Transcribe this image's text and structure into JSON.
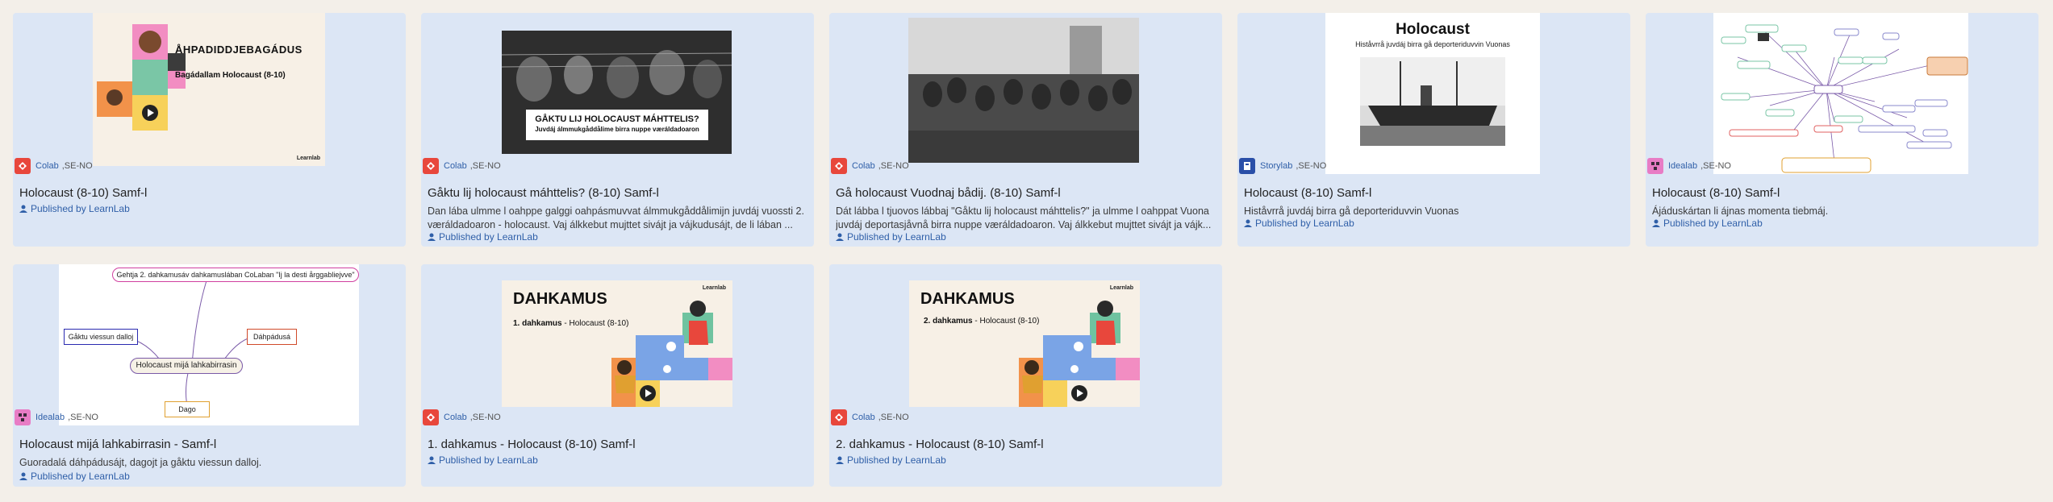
{
  "cards": [
    {
      "title": "Holocaust (8-10) Samf-l",
      "lab": "Colab",
      "lang": ",SE-NO",
      "description": "",
      "publisher": "Published by LearnLab",
      "thumb": {
        "heading": "ÅHPADIDDJEBAGÁDUS",
        "sub": "Bagádallam Holocaust (8-10)",
        "brand": "Learnlab"
      }
    },
    {
      "title": "Gåktu lij holocaust máhttelis? (8-10) Samf-l",
      "lab": "Colab",
      "lang": ",SE-NO",
      "description": "Dan lába ulmme l oahppe galggi oahpásmuvvat álmmukgåddålimijn juvdáj vuossti 2. væráldadoaron - holocaust. Vaj álkkebut mujttet sivájt ja vájkudusájt, de li lában ...",
      "publisher": "Published by LearnLab",
      "thumb": {
        "heading": "GÅKTU LIJ HOLOCAUST MÁHTTELIS?",
        "sub": "Juvdáj álmmukgåddålime birra nuppe væráldadoaron"
      }
    },
    {
      "title": "Gå holocaust Vuodnaj bådij. (8-10) Samf-l",
      "lab": "Colab",
      "lang": ",SE-NO",
      "description": "Dát lábba l tjuovos lábbaj \"Gåktu lij holocaust máhttelis?\" ja ulmme l oahppat Vuona juvdáj deportasjåvnå birra nuppe væráldadoaron. Vaj álkkebut mujttet sivájt ja vájk...",
      "publisher": "Published by LearnLab",
      "thumb": {}
    },
    {
      "title": "Holocaust (8-10) Samf-l",
      "lab": "Storylab",
      "lang": ",SE-NO",
      "description": "Histåvrrå juvdáj birra gå deporteriduvvin Vuonas",
      "publisher": "Published by LearnLab",
      "thumb": {
        "heading": "Holocaust",
        "sub": "Histåvrrå juvdáj birra gå deporteriduvvin Vuonas"
      }
    },
    {
      "title": "Holocaust (8-10) Samf-l",
      "lab": "Idealab",
      "lang": ",SE-NO",
      "description": "Ájáduskártan li ájnas momenta tiebmáj.",
      "publisher": "Published by LearnLab",
      "thumb": {}
    },
    {
      "title": "Holocaust mijá lahkabirrasin - Samf-l",
      "lab": "Idealab",
      "lang": ",SE-NO",
      "description": "Guoradalá dáhpádusájt, dagojt ja gåktu viessun dalloj.",
      "publisher": "Published by LearnLab",
      "thumb": {
        "top": "Gehtja 2. dahkamusáv dahkamuslában CoLaban \"Ij la desti årggabliejvve\"",
        "left": "Gåktu viessun dalloj",
        "right": "Dáhpádusá",
        "center": "Holocaust mijá lahkabirrasin",
        "bottom": "Dago"
      }
    },
    {
      "title": "1. dahkamus - Holocaust (8-10) Samf-l",
      "lab": "Colab",
      "lang": ",SE-NO",
      "description": "",
      "publisher": "Published by LearnLab",
      "thumb": {
        "heading": "DAHKAMUS",
        "num": "1. dahkamus",
        "sub": " - Holocaust (8-10)",
        "brand": "Learnlab"
      }
    },
    {
      "title": "2. dahkamus - Holocaust (8-10) Samf-l",
      "lab": "Colab",
      "lang": ",SE-NO",
      "description": "",
      "publisher": "Published by LearnLab",
      "thumb": {
        "heading": "DAHKAMUS",
        "num": "2. dahkamus",
        "sub": " - Holocaust (8-10)",
        "brand": "Learnlab"
      }
    }
  ],
  "colors": {
    "card_bg": "#dce6f5",
    "page_bg": "#f3efe9",
    "link": "#2f5fa8",
    "colab_badge": "#e8473c",
    "storylab_badge": "#2a4fa8",
    "idealab_badge": "#e87cc5"
  },
  "icons": {
    "colab": "colab-icon",
    "storylab": "storylab-icon",
    "idealab": "idealab-icon",
    "publisher": "user-icon",
    "play": "play-icon"
  }
}
